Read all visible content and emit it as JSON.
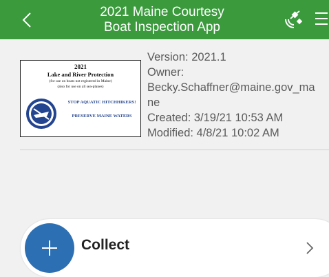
{
  "header": {
    "title": "2021 Maine Courtesy Boat Inspection App",
    "back_icon": "chevron-left-icon",
    "satellite_icon": "satellite-icon",
    "menu_icon": "menu-icon",
    "color": "#3a9a3c"
  },
  "thumbnail": {
    "year": "2021",
    "heading": "Lake and River Protection",
    "note1": "(for use on boats not registered in Maine)",
    "note2": "(also for use on all sea-planes)",
    "stop": "STOP AQUATIC HITCHHIKERS!",
    "preserve": "PRESERVE MAINE WATERS",
    "badge_icon": "boat-badge-icon"
  },
  "info": {
    "version": "Version: 2021.1",
    "owner_label": "Owner:",
    "owner_line1": "Becky.Schaffner@maine.gov_ma",
    "owner_line2": "ne",
    "created": "Created: 3/19/21 10:53 AM",
    "modified": "Modified: 4/8/21 10:02 AM"
  },
  "collect": {
    "label": "Collect",
    "plus_icon": "plus-icon",
    "chevron_icon": "chevron-right-icon",
    "accent": "#2c6fb3"
  }
}
